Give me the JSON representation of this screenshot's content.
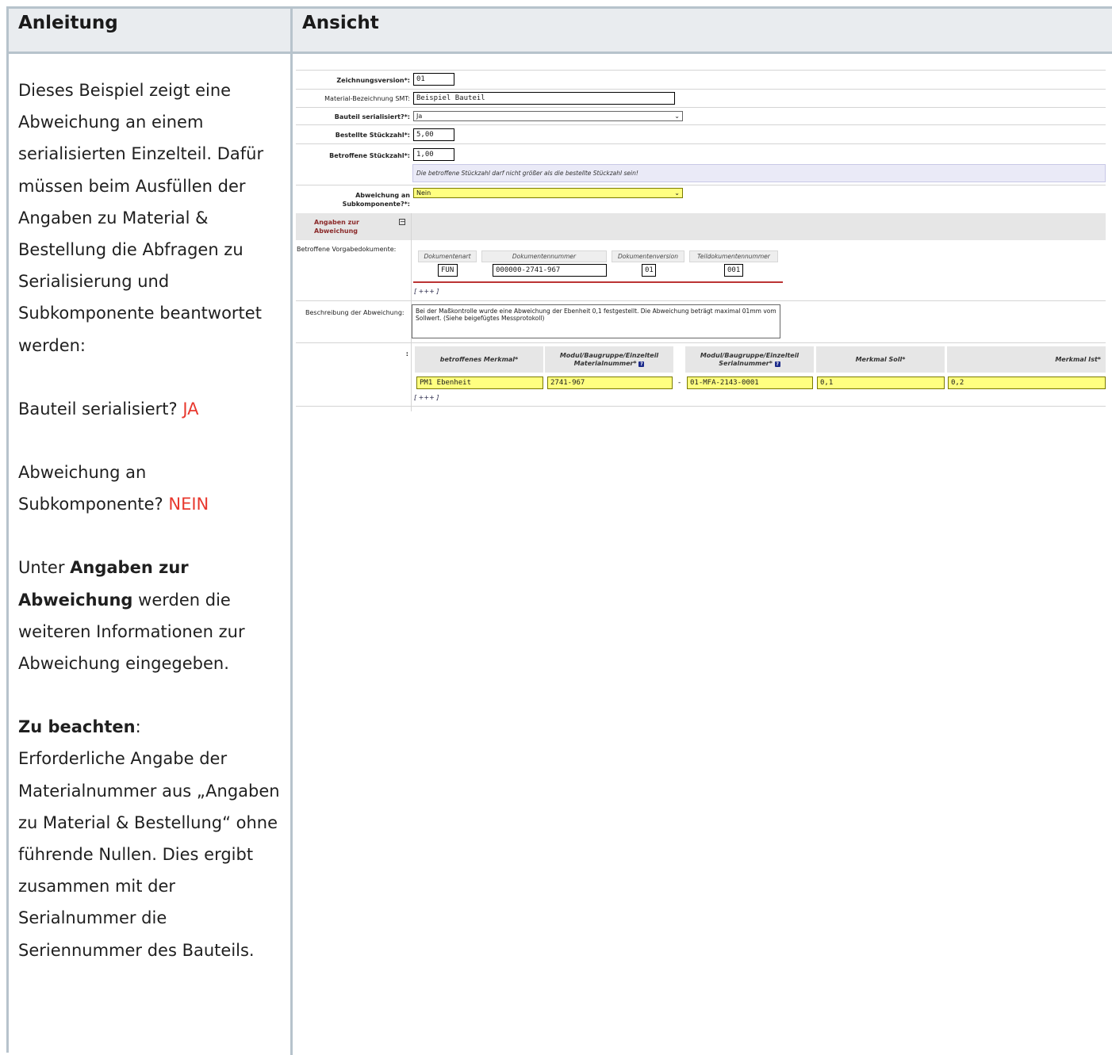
{
  "headers": {
    "left": "Anleitung",
    "right": "Ansicht"
  },
  "instructions": {
    "intro": "Dieses Beispiel zeigt eine Abweichung an einem serialisierten Einzelteil. Dafür müssen beim Ausfüllen der Angaben zu Material & Bestellung die Abfragen zu Serialisierung und Subkomponente beantwortet werden:",
    "q1_text": "Bauteil serialisiert? ",
    "q1_answer": "JA",
    "q2_text": "Abweichung an Subkomponente? ",
    "q2_answer": "NEIN",
    "section_prefix": "Unter ",
    "section_bold": "Angaben zur Abweichung",
    "section_suffix": " werden die weiteren Informationen zur Abweichung eingegeben.",
    "note_bold": "Zu beachten",
    "note_colon": ":",
    "note_text": "Erforderliche Angabe der Materialnummer aus „Angaben zu Material & Bestellung“ ohne führende Nullen. Dies ergibt zusammen mit der Serialnummer die Seriennummer des Bauteils.",
    "highlight_color": "#e8382e"
  },
  "form": {
    "zeichnungsversion": {
      "label": "Zeichnungsversion*:",
      "value": "01"
    },
    "material_bezeichnung": {
      "label": "Material-Bezeichnung SMT:",
      "value": "Beispiel Bauteil"
    },
    "bauteil_serialisiert": {
      "label": "Bauteil serialisiert?*:",
      "value": "Ja"
    },
    "bestellte_stueckzahl": {
      "label": "Bestellte Stückzahl*:",
      "value": "5,00"
    },
    "betroffene_stueckzahl": {
      "label": "Betroffene Stückzahl*:",
      "value": "1,00"
    },
    "hint": "Die betroffene Stückzahl darf nicht größer als die bestellte Stückzahl sein!",
    "abweichung_subkomponente": {
      "label_1": "Abweichung an",
      "label_2": "Subkomponente?*:",
      "value": "Nein"
    },
    "section": {
      "title_1": "Angaben zur",
      "title_2": "Abweichung",
      "toggle": "−"
    },
    "vorgabedokumente": {
      "label": "Betroffene Vorgabedokumente:",
      "headers": [
        "Dokumentenart",
        "Dokumentennummer",
        "Dokumentenversion",
        "Teildokumentennummer"
      ],
      "values": [
        "FUN",
        "000000-2741-967",
        "01",
        "001"
      ],
      "add": "[ +++ ]"
    },
    "beschreibung": {
      "label": "Beschreibung der Abweichung:",
      "value": "Bei der Maßkontrolle wurde eine Abweichung der Ebenheit 0,1 festgestellt. Die Abweichung beträgt maximal 01mm vom Sollwert. (Siehe beigefügtes Messprotokoll)"
    },
    "merkmale": {
      "label": ":",
      "headers": [
        "betroffenes Merkmal*",
        "Modul/Baugruppe/Einzelteil Materialnummer*",
        "Modul/Baugruppe/Einzelteil Serialnummer*",
        "Merkmal Soll*",
        "Merkmal Ist*"
      ],
      "help_icon": "?",
      "dash": "-",
      "values": [
        "PM1 Ebenheit",
        "2741-967",
        "01-MFA-2143-0001",
        "0,1",
        "0,2"
      ],
      "add": "[ +++ ]"
    },
    "select_chevron": "⌄"
  }
}
